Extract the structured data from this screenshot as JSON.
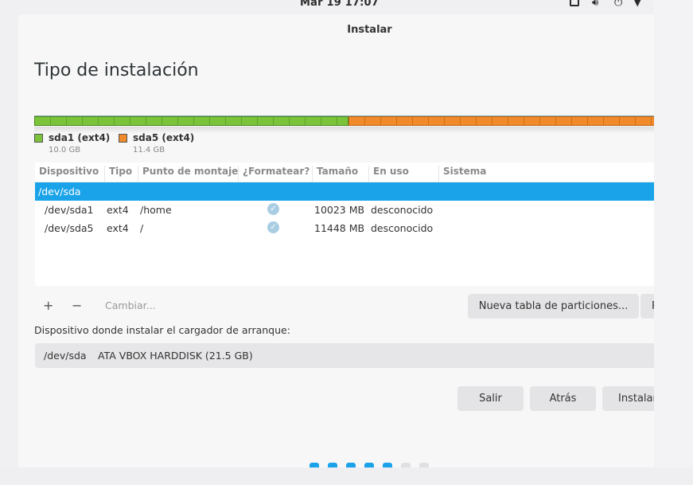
{
  "topbar": {
    "clock": "Mar 19  17:07",
    "icons": [
      "window-icon",
      "volume-icon",
      "power-icon",
      "caret-down-icon"
    ]
  },
  "window": {
    "title": "Instalar",
    "heading": "Tipo de instalación"
  },
  "disk": {
    "partitions": [
      {
        "name": "sda1 (ext4)",
        "size": "10.0 GB",
        "color": "#7bc43a",
        "fraction": 0.4935
      },
      {
        "name": "sda5 (ext4)",
        "size": "11.4 GB",
        "color": "#f08a2a",
        "fraction": 0.5065
      }
    ]
  },
  "table": {
    "columns": [
      "Dispositivo",
      "Tipo",
      "Punto de montaje",
      "¿Formatear?",
      "Tamaño",
      "En uso",
      "Sistema"
    ],
    "group_row": "/dev/sda",
    "rows": [
      {
        "device": "/dev/sda1",
        "type": "ext4",
        "mount": "/home",
        "format": true,
        "size": "10023 MB",
        "used": "desconocido",
        "system": ""
      },
      {
        "device": "/dev/sda5",
        "type": "ext4",
        "mount": "/",
        "format": true,
        "size": "11448 MB",
        "used": "desconocido",
        "system": ""
      }
    ]
  },
  "toolbar": {
    "add": "+",
    "remove": "−",
    "change": "Cambiar...",
    "new_table": "Nueva tabla de particiones...",
    "revert": "R"
  },
  "bootloader": {
    "label": "Dispositivo donde instalar el cargador de arranque:",
    "device": "/dev/sda",
    "description": "ATA VBOX HARDDISK (21.5 GB)"
  },
  "actions": {
    "quit": "Salir",
    "back": "Atrás",
    "install": "Instalar"
  },
  "progress": {
    "total_steps": 7,
    "completed_steps": 5,
    "active_color": "#1aa3e8",
    "inactive_color": "#e0e0e4"
  }
}
